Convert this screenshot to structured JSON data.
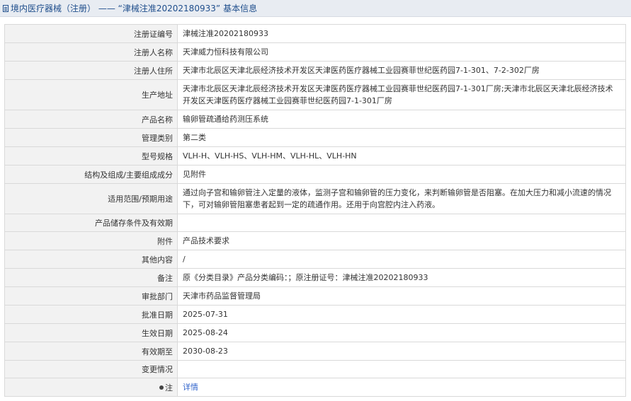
{
  "title": {
    "prefix": "境内医疗器械（注册）",
    "separator": " —— ",
    "subject": "“津械注准20202180933”",
    "suffix": "基本信息"
  },
  "fields": [
    {
      "label": "注册证编号",
      "value": "津械注准20202180933"
    },
    {
      "label": "注册人名称",
      "value": "天津威力恒科技有限公司"
    },
    {
      "label": "注册人住所",
      "value": "天津市北辰区天津北辰经济技术开发区天津医药医疗器械工业园赛菲世纪医药园7-1-301、7-2-302厂房"
    },
    {
      "label": "生产地址",
      "value": "天津市北辰区天津北辰经济技术开发区天津医药医疗器械工业园赛菲世纪医药园7-1-301厂房;天津市北辰区天津北辰经济技术开发区天津医药医疗器械工业园赛菲世纪医药园7-1-301厂房"
    },
    {
      "label": "产品名称",
      "value": "输卵管疏通给药测压系统"
    },
    {
      "label": "管理类别",
      "value": "第二类"
    },
    {
      "label": "型号规格",
      "value": "VLH-H、VLH-HS、VLH-HM、VLH-HL、VLH-HN"
    },
    {
      "label": "结构及组成/主要组成成分",
      "value": "见附件"
    },
    {
      "label": "适用范围/预期用途",
      "value": "通过向子宫和输卵管注入定量的液体，监测子宫和输卵管的压力变化，来判断输卵管是否阻塞。在加大压力和减小流速的情况下，可对输卵管阻塞患者起到一定的疏通作用。还用于向宫腔内注入药液。"
    },
    {
      "label": "产品储存条件及有效期",
      "value": ""
    },
    {
      "label": "附件",
      "value": "产品技术要求"
    },
    {
      "label": "其他内容",
      "value": "/"
    },
    {
      "label": "备注",
      "value": "原《分类目录》产品分类编码：；原注册证号：津械注准20202180933"
    },
    {
      "label": "审批部门",
      "value": "天津市药品监督管理局"
    },
    {
      "label": "批准日期",
      "value": "2025-07-31"
    },
    {
      "label": "生效日期",
      "value": "2025-08-24"
    },
    {
      "label": "有效期至",
      "value": "2030-08-23"
    },
    {
      "label": "变更情况",
      "value": ""
    }
  ],
  "note": {
    "label": "注",
    "link": "详情",
    "icon": "pin-icon"
  },
  "colors": {
    "title_text": "#1f4e8c",
    "link": "#3366cc",
    "label_bg": "#f2f2f2",
    "title_bg": "#e8ecf2"
  }
}
